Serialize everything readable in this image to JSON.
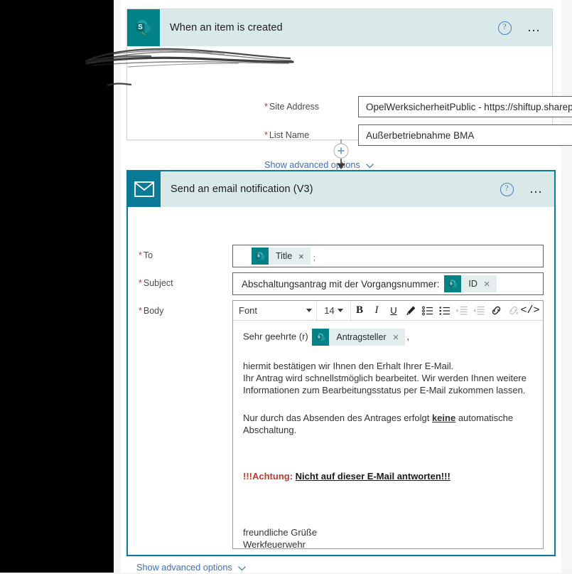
{
  "app": {
    "colors": {
      "sharepoint_teal": "#038387",
      "email_teal": "#0b7a96",
      "header_bg": "#d9e9ea",
      "link_blue": "#3a6fc4",
      "required_red": "#c0392b",
      "canvas_bg": "#f6f6f6"
    }
  },
  "trigger_card": {
    "icon": "sharepoint-icon",
    "title": "When an item is created",
    "help_label": "?",
    "more_label": "• • •",
    "fields": [
      {
        "name": "site-address",
        "required": "*",
        "label": "Site Address",
        "value": "OpelWerksicherheitPublic - https://shiftup.sharepoint.com/sites...",
        "redacted": true
      },
      {
        "name": "list-name",
        "required": "*",
        "label": "List Name",
        "value": "Außerbetriebnahme BMA",
        "redacted": false
      }
    ],
    "advanced_options_label": "Show advanced options"
  },
  "connector": {
    "add_label": "+",
    "name": "add-step-button"
  },
  "email_card": {
    "icon": "envelope-icon",
    "title": "Send an email notification (V3)",
    "help_label": "?",
    "more_label": "• • •",
    "to": {
      "required": "*",
      "label": "To",
      "chip": {
        "label": "Title",
        "close": "×",
        "icon": "sharepoint-token-icon"
      },
      "trailing_text": ";"
    },
    "subject": {
      "required": "*",
      "label": "Subject",
      "text": "Abschaltungsantrag mit der Vorgangsnummer:",
      "chip": {
        "label": "ID",
        "close": "×",
        "icon": "sharepoint-token-icon"
      }
    },
    "body": {
      "required": "*",
      "label": "Body",
      "toolbar": {
        "font_label": "Font",
        "size_label": "14",
        "bold": "B",
        "italic": "I",
        "underline": "U",
        "text_color": "pen-icon",
        "numbered_list": "numbered-list-icon",
        "bullet_list": "bullet-list-icon",
        "indent_increase": "indent-increase-icon",
        "indent_decrease": "indent-decrease-icon",
        "link": "link-icon",
        "unlink": "unlink-icon",
        "code_view": "</>"
      },
      "content": {
        "salutation_prefix": "Sehr geehrte (r)",
        "salutation_chip": {
          "label": "Antragsteller",
          "close": "×",
          "icon": "sharepoint-token-icon"
        },
        "salutation_suffix": ",",
        "paragraph1_line1": "hiermit bestätigen wir Ihnen den Erhalt Ihrer E-Mail.",
        "paragraph1_line2": "Ihr Antrag wird schnellstmöglich bearbeitet. Wir werden Ihnen weitere",
        "paragraph1_line3": "Informationen zum Bearbeitungsstatus per E-Mail zukommen lassen.",
        "paragraph2_pre": "Nur durch das Absenden des Antrages erfolgt ",
        "paragraph2_emph": "keine",
        "paragraph2_post": " automatische",
        "paragraph2_line2": "Abschaltung.",
        "warning_red": "!!!Achtung:",
        "warning_dark": "Nicht auf dieser E-Mail antworten!!!",
        "closing_line1": "freundliche Grüße",
        "closing_line2": "Werkfeuerwehr"
      }
    },
    "advanced_options_label": "Show advanced options"
  }
}
